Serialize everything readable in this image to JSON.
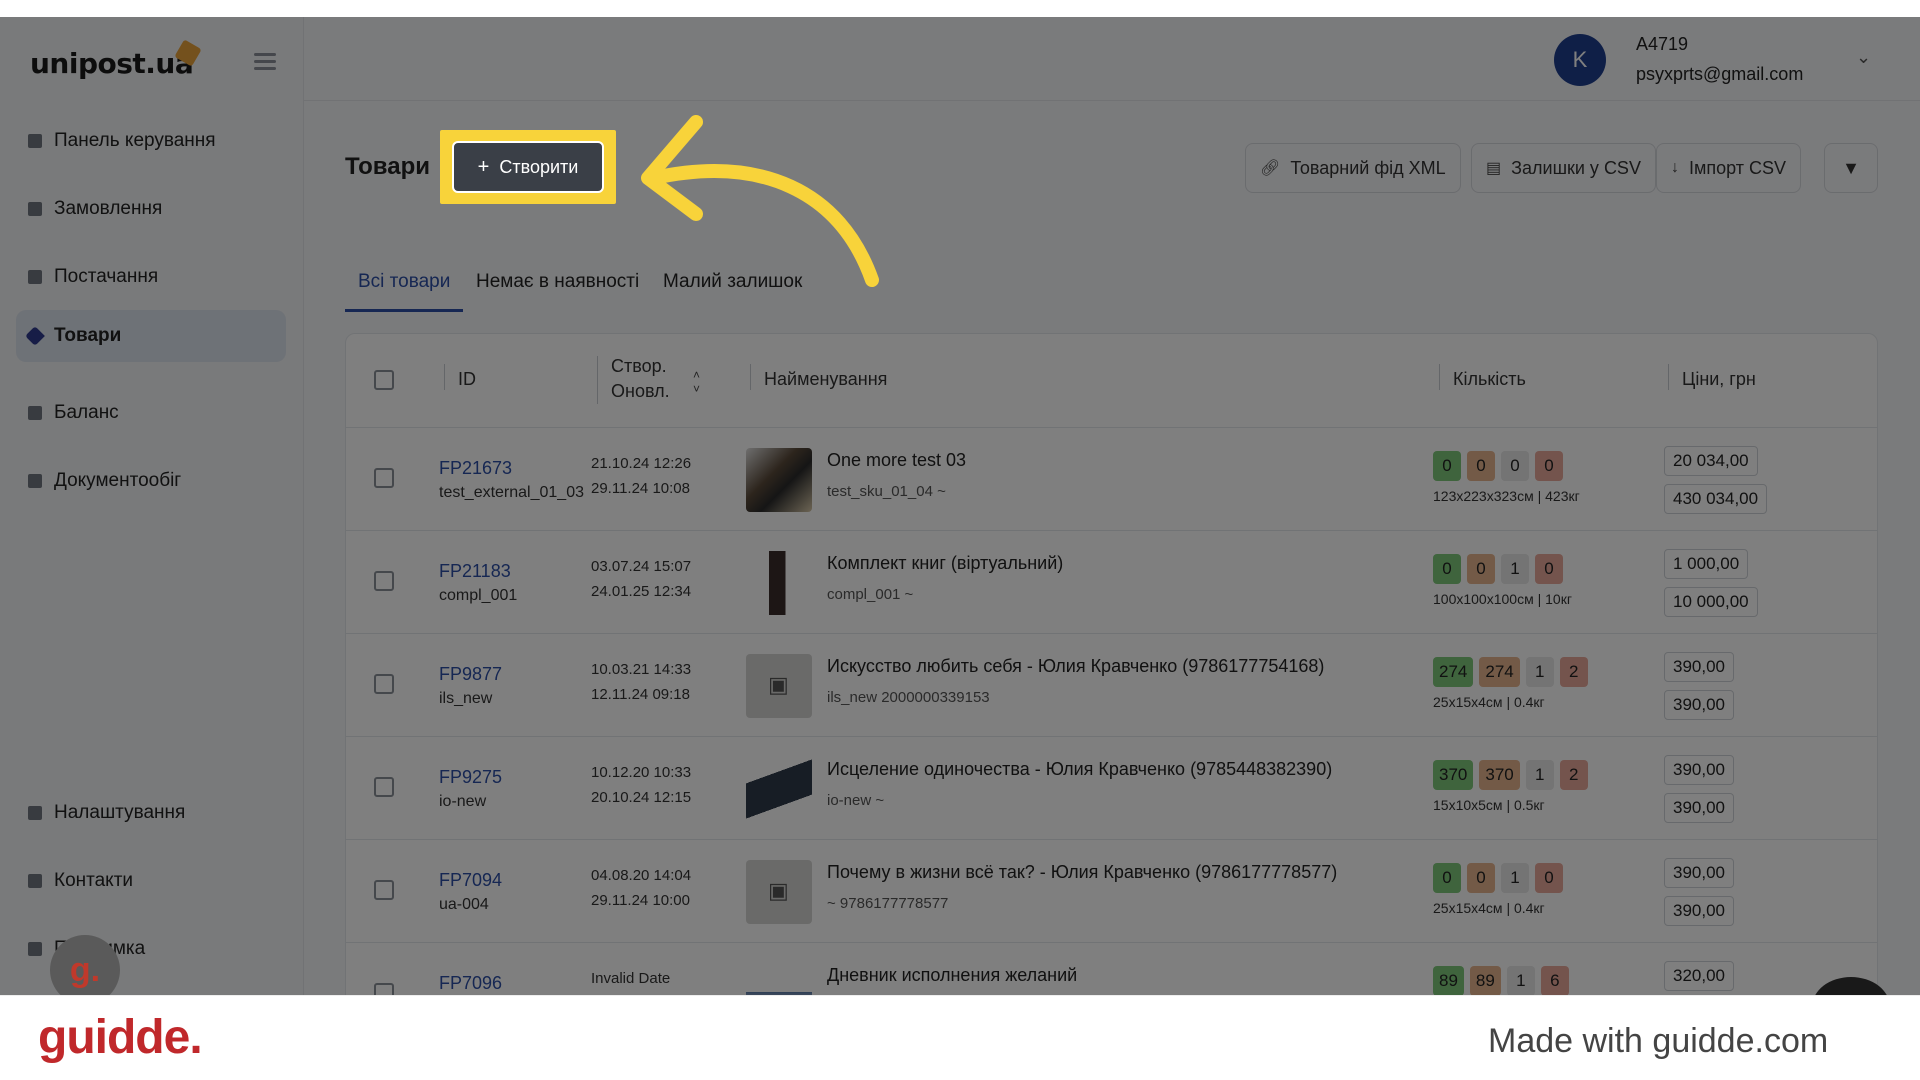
{
  "brand": {
    "name": "unipost.ua"
  },
  "account": {
    "initial": "K",
    "name": "A4719",
    "email": "psyxprts@gmail.com"
  },
  "sidebar": {
    "items": [
      {
        "label": "Панель керування",
        "active": false
      },
      {
        "label": "Замовлення",
        "active": false
      },
      {
        "label": "Постачання",
        "active": false
      },
      {
        "label": "Товари",
        "active": true
      },
      {
        "label": "Баланс",
        "active": false
      },
      {
        "label": "Документообіг",
        "active": false
      }
    ],
    "bottom_items": [
      {
        "label": "Налаштування"
      },
      {
        "label": "Контакти"
      },
      {
        "label": "Підтримка"
      }
    ]
  },
  "page": {
    "title": "Товари",
    "create_label": "Створити",
    "tools": [
      {
        "label": "Товарний фід XML",
        "icon": "link-icon"
      },
      {
        "label": "Залишки у CSV",
        "icon": "file-icon"
      },
      {
        "label": "Імпорт CSV",
        "icon": "download-icon"
      }
    ],
    "filter_icon": "filter-icon"
  },
  "tabs": [
    {
      "label": "Всі товари",
      "active": true
    },
    {
      "label": "Немає в наявності",
      "active": false
    },
    {
      "label": "Малий залишок",
      "active": false
    }
  ],
  "table": {
    "headers": {
      "id": "ID",
      "created": "Створ.",
      "updated": "Оновл.",
      "name": "Найменування",
      "qty": "Кількість",
      "prices": "Ціни, грн"
    },
    "rows": [
      {
        "id": "FP21673",
        "sub": "test_external_01_03",
        "created": "21.10.24 12:26",
        "updated": "29.11.24 10:08",
        "name": "One more test 03",
        "sku": "test_sku_01_04  ~",
        "qty": [
          "0",
          "0",
          "0",
          "0"
        ],
        "dims": "123x223x323см | 423кг",
        "price1": "20 034,00",
        "price2": "430 034,00"
      },
      {
        "id": "FP21183",
        "sub": "compl_001",
        "created": "03.07.24 15:07",
        "updated": "24.01.25 12:34",
        "name": "Комплект книг (віртуальний)",
        "sku": "compl_001  ~",
        "qty": [
          "0",
          "0",
          "1",
          "0"
        ],
        "dims": "100x100x100см | 10кг",
        "price1": "1 000,00",
        "price2": "10 000,00"
      },
      {
        "id": "FP9877",
        "sub": "ils_new",
        "created": "10.03.21 14:33",
        "updated": "12.11.24 09:18",
        "name": "Искусство любить себя - Юлия Кравченко (9786177754168)",
        "sku": "ils_new  2000000339153",
        "qty": [
          "274",
          "274",
          "1",
          "2"
        ],
        "dims": "25x15x4см | 0.4кг",
        "price1": "390,00",
        "price2": "390,00"
      },
      {
        "id": "FP9275",
        "sub": "io-new",
        "created": "10.12.20 10:33",
        "updated": "20.10.24 12:15",
        "name": "Исцеление одиночества - Юлия Кравченко (9785448382390)",
        "sku": "io-new  ~",
        "qty": [
          "370",
          "370",
          "1",
          "2"
        ],
        "dims": "15x10x5см | 0.5кг",
        "price1": "390,00",
        "price2": "390,00"
      },
      {
        "id": "FP7094",
        "sub": "ua-004",
        "created": "04.08.20 14:04",
        "updated": "29.11.24 10:00",
        "name": "Почему в жизни всё так? - Юлия Кравченко (9786177778577)",
        "sku": "~  9786177778577",
        "qty": [
          "0",
          "0",
          "1",
          "0"
        ],
        "dims": "25x15x4см | 0.4кг",
        "price1": "390,00",
        "price2": "390,00"
      },
      {
        "id": "FP7096",
        "sub": "",
        "created": "Invalid Date",
        "updated": "",
        "name": "Дневник исполнения желаний",
        "sku": "",
        "qty": [
          "89",
          "89",
          "1",
          "6"
        ],
        "dims": "",
        "price1": "320,00",
        "price2": ""
      }
    ]
  },
  "footer": {
    "logo": "guidde.",
    "badge": "g.",
    "made_with": "Made with guidde.com"
  },
  "colors": {
    "accent": "#2d4fa6",
    "highlight": "#f8d33a",
    "brand_red": "#c0282b"
  }
}
